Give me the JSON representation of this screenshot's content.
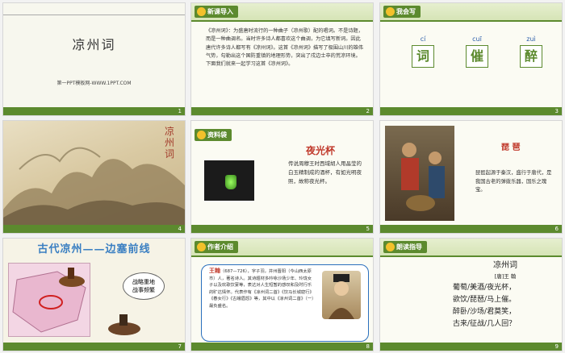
{
  "slides": [
    {
      "num": "1",
      "title": "凉州词",
      "site": "第一PPT模板网-WWW.1PPT.COM"
    },
    {
      "num": "2",
      "tag": "新课导入",
      "body_hl": "《凉州词》",
      "body": "《凉州词》：为盛唐时流行的一种曲子（凉州歌）配的唱词。不是诗题，而是一种曲调名。当时许多诗人都喜欢这个曲调，为它填写新词。因此唐代许多诗人都写有《凉州词》。这首《凉州词》描写了极围山川的雄伟气势，勾勒出这个国防重镇的地理形势，突出了戍边士卒的荒凉环境。下面我们就来一起学习这首《凉州词》。"
    },
    {
      "num": "3",
      "tag": "我会写",
      "chars": [
        {
          "py": "cí",
          "ch": "词"
        },
        {
          "py": "cuī",
          "ch": "催"
        },
        {
          "py": "zuì",
          "ch": "醉"
        }
      ]
    },
    {
      "num": "4",
      "vert": "凉州词"
    },
    {
      "num": "5",
      "tag": "资料袋",
      "title": "夜光杯",
      "text": "传说周穆王时西域胡人用晶莹的白玉精制成的酒杯，有如光明夜照，故称夜光杯。"
    },
    {
      "num": "6",
      "title": "琵 琶",
      "text": "琵琶起源于秦汉，盛行于唐代，是我国古老的弹拨乐器，国乐之瑰宝。"
    },
    {
      "num": "7",
      "title": "古代凉州——边塞前线",
      "bubble": "战略重地\n战事频繁"
    },
    {
      "num": "8",
      "tag": "作者介绍",
      "name": "王翰",
      "text": "（687—726），字子羽，并州晋阳（今山西太原市）人，著名诗人。其诗题材多吟咏沙场少年、玲珑女子以及欢歌饮宴等，表达对人生短暂的感叹和及时行乐的旷达情怀。代表作有《凉州词二首》《饮马长城窟行》《春女行》《古蛾眉怨》等，其中以《凉州词二首》（一）最负盛名。"
    },
    {
      "num": "9",
      "tag": "朗读指导",
      "poem_title": "凉州词",
      "author": "[唐]王 翰",
      "lines": [
        "葡萄/美酒/夜光杯，",
        "欲饮/琵琶/马上催。",
        "醉卧/沙场/君莫笑，",
        "古来/征战/几人回？"
      ]
    }
  ],
  "colors": {
    "footer": "#5c8a2e",
    "accent_red": "#c0392b",
    "accent_blue": "#2a6fbd"
  }
}
